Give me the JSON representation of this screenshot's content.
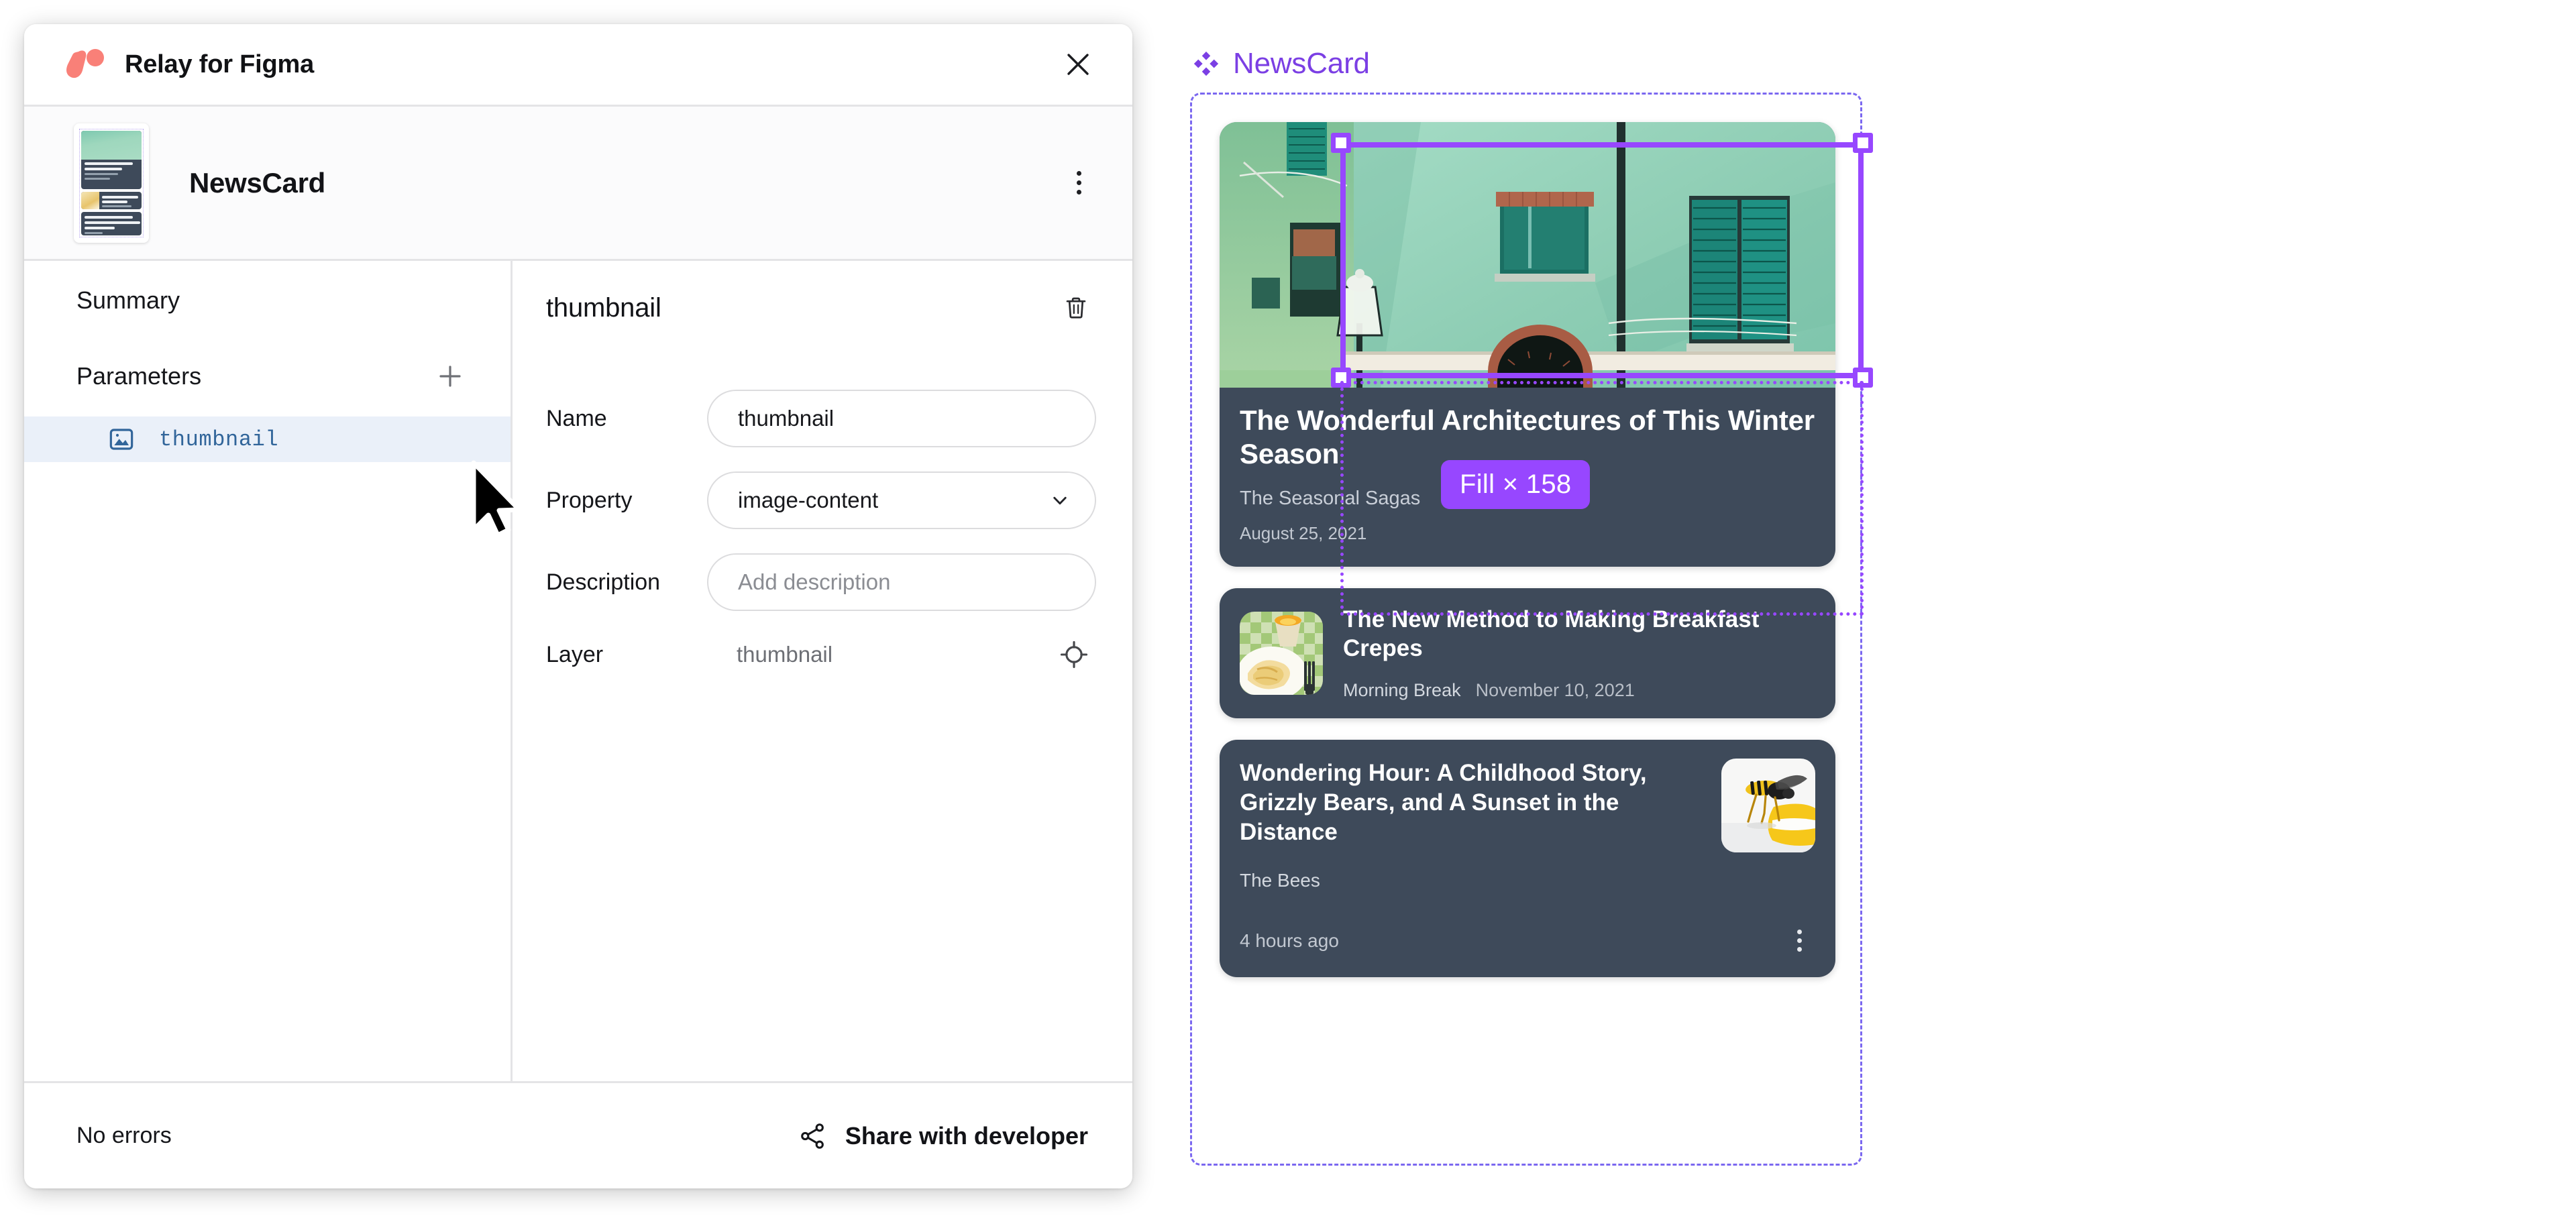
{
  "plugin": {
    "title": "Relay for Figma",
    "logo_icon": "relay-logo-icon",
    "close_icon": "close-icon",
    "component": {
      "name": "NewsCard",
      "menu_icon": "vertical-dots-icon",
      "thumbnail_icon": "component-thumbnail-preview"
    },
    "sidebar": {
      "summary_label": "Summary",
      "parameters_label": "Parameters",
      "add_icon": "plus-icon",
      "parameters": [
        {
          "label": "thumbnail",
          "icon": "image-icon",
          "selected": true
        }
      ]
    },
    "detail": {
      "title": "thumbnail",
      "delete_icon": "trash-icon",
      "fields": {
        "name_label": "Name",
        "name_value": "thumbnail",
        "property_label": "Property",
        "property_value": "image-content",
        "property_chevron_icon": "chevron-down-icon",
        "description_label": "Description",
        "description_value": "",
        "description_placeholder": "Add description",
        "layer_label": "Layer",
        "layer_value": "thumbnail",
        "layer_locate_icon": "target-crosshair-icon"
      }
    },
    "footer": {
      "status": "No errors",
      "share_label": "Share with developer",
      "share_icon": "share-nodes-icon"
    }
  },
  "canvas": {
    "frame_label": "NewsCard",
    "frame_label_icon": "figma-component-diamond-icon",
    "selection_badge": "Fill × 158",
    "cursor_icon": "mouse-pointer-icon",
    "colors": {
      "accent_purple": "#9747FF",
      "frame_purple": "#7B68F0",
      "label_purple": "#7B3FE4",
      "card_bg": "#3E4A5A",
      "relay_coral": "#F98078",
      "param_blue": "#31659A"
    },
    "cards": [
      {
        "id": "hero",
        "title": "The Wonderful Architectures of This Winter Season",
        "source": "The Seasonal Sagas",
        "date": "August 25, 2021",
        "image_alt": "green-building-facade-with-shutters"
      },
      {
        "id": "crepes",
        "title": "The New Method to Making Breakfast Crepes",
        "source": "Morning Break",
        "date": "November 10, 2021",
        "image_alt": "breakfast-crepes-on-plate"
      },
      {
        "id": "bees",
        "title": "Wondering Hour: A Childhood Story, Grizzly Bears, and A Sunset in the Distance",
        "source": "The Bees",
        "date": "4 hours ago",
        "image_alt": "wasp-on-yellow-object",
        "menu_icon": "vertical-dots-icon"
      }
    ]
  }
}
